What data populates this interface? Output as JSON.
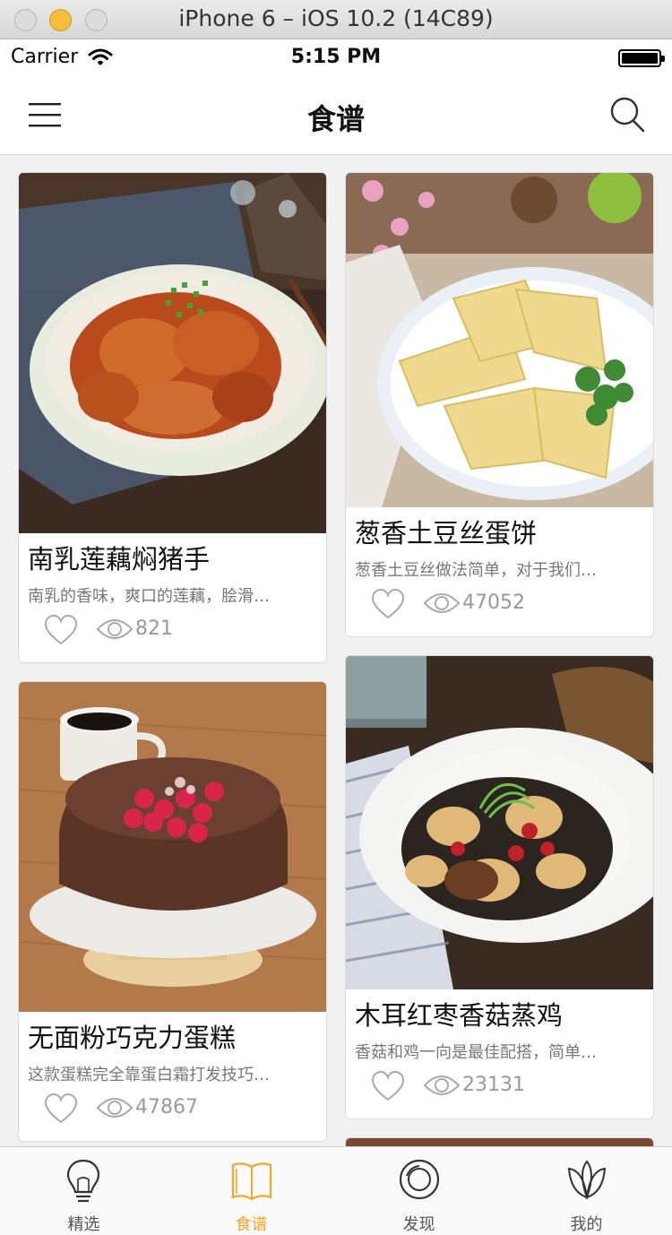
{
  "simulator": {
    "title": "iPhone 6 – iOS 10.2 (14C89)"
  },
  "status_bar": {
    "carrier": "Carrier",
    "time": "5:15 PM"
  },
  "nav": {
    "title": "食谱",
    "menu_icon": "hamburger-menu-icon",
    "search_icon": "search-icon"
  },
  "colors": {
    "accent": "#f5a623",
    "text": "#111111",
    "muted": "#999999"
  },
  "recipes": [
    {
      "title": "南乳莲藕焖猪手",
      "desc": "南乳的香味，爽口的莲藕，脍滑…",
      "views": "821"
    },
    {
      "title": "葱香土豆丝蛋饼",
      "desc": "葱香土豆丝做法简单，对于我们…",
      "views": "47052"
    },
    {
      "title": "无面粉巧克力蛋糕",
      "desc": "这款蛋糕完全靠蛋白霜打发技巧…",
      "views": "47867"
    },
    {
      "title": "木耳红枣香菇蒸鸡",
      "desc": "香菇和鸡一向是最佳配搭，简单…",
      "views": "23131"
    }
  ],
  "tabs": [
    {
      "label": "精选",
      "icon": "lightbulb-icon",
      "active": false
    },
    {
      "label": "食谱",
      "icon": "open-book-icon",
      "active": true
    },
    {
      "label": "发现",
      "icon": "discover-circle-icon",
      "active": false
    },
    {
      "label": "我的",
      "icon": "leaf-flower-icon",
      "active": false
    }
  ]
}
